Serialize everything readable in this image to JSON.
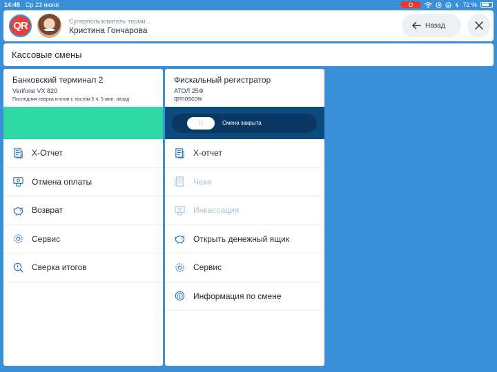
{
  "status": {
    "time": "14:45",
    "date": "Ср 23 июня",
    "battery": "72 %",
    "battery_level": 0.72
  },
  "header": {
    "logo_text": "QR",
    "user_role": "Суперпользователь терми...",
    "user_name": "Кристина Гончарова",
    "back_label": "Назад"
  },
  "page_title": "Кассовые смены",
  "bank_terminal": {
    "title": "Банковский терминал 2",
    "model": "Verifone VX 820",
    "last_sync": "Последняя сверка итогов с хостом 5 ч. 5 мин. назад",
    "status_color": "#2fd9a6",
    "menu": [
      {
        "label": "X-Отчет",
        "icon": "report-icon",
        "enabled": true
      },
      {
        "label": "Отмена оплаты",
        "icon": "cancel-payment-icon",
        "enabled": true
      },
      {
        "label": "Возврат",
        "icon": "refund-icon",
        "enabled": true
      },
      {
        "label": "Сервис",
        "icon": "gear-icon",
        "enabled": true
      },
      {
        "label": "Сверка итогов",
        "icon": "reconcile-icon",
        "enabled": true
      }
    ]
  },
  "fiscal_register": {
    "title": "Фискальный регистратор",
    "model": "АТОЛ 25Ф",
    "account": "qrmoscow",
    "shift_toggle_label": "Смена закрыта",
    "status_color": "#0d4a7e",
    "menu": [
      {
        "label": "X-отчет",
        "icon": "report-icon",
        "enabled": true
      },
      {
        "label": "Чеки",
        "icon": "receipts-icon",
        "enabled": false
      },
      {
        "label": "Инкассация",
        "icon": "collection-icon",
        "enabled": false
      },
      {
        "label": "Открыть денежный ящик",
        "icon": "cash-drawer-icon",
        "enabled": true
      },
      {
        "label": "Сервис",
        "icon": "gear-icon",
        "enabled": true
      },
      {
        "label": "Информация по смене",
        "icon": "info-icon",
        "enabled": true
      }
    ]
  },
  "colors": {
    "background": "#3a8fd6",
    "accent": "#1f6fb6",
    "disabled_text": "#a9c3d9"
  }
}
